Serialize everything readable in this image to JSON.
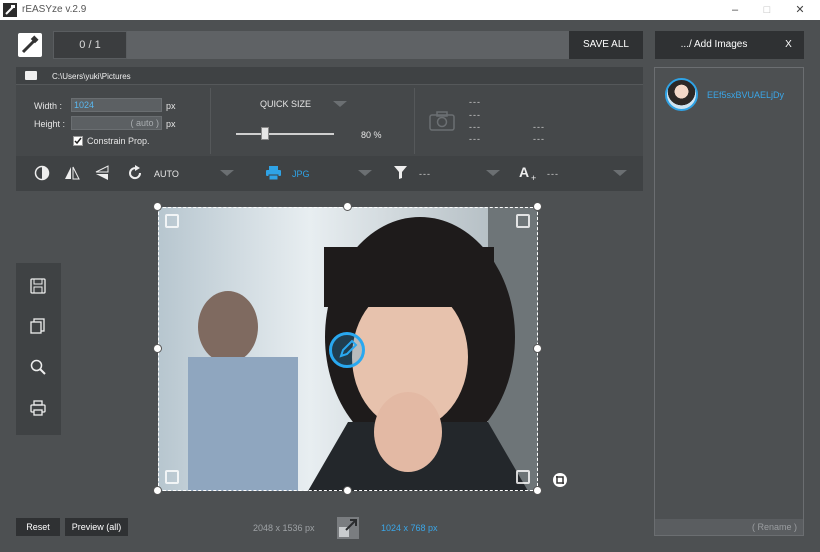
{
  "window": {
    "title": "rEASYze v.2.9",
    "minimize": "–",
    "maximize": "□",
    "close": "✕"
  },
  "toolbar": {
    "counter": "0 / 1",
    "save_all": "SAVE ALL",
    "add_images": ".../ Add Images",
    "close_x": "X"
  },
  "path": {
    "text": "C:\\Users\\yuki\\Pictures"
  },
  "size": {
    "width_label": "Width :",
    "width_value": "1024",
    "width_unit": "px",
    "height_label": "Height :",
    "height_placeholder": "( auto )",
    "height_unit": "px",
    "constrain_label": "Constrain Prop.",
    "constrain_checked": true
  },
  "quick_size": {
    "label": "QUICK SIZE",
    "value": "80 %",
    "fraction": 0.3
  },
  "exif": {
    "lines_left": [
      "---",
      "---",
      "---",
      "---"
    ],
    "lines_right": [
      "---",
      "---"
    ]
  },
  "effects": {
    "auto_label": "AUTO",
    "format_label": "JPG",
    "filter_value": "---",
    "text_value": "---",
    "accent": "#2fa3e6"
  },
  "files": [
    {
      "name": "EEf5sxBVUAELjDy"
    }
  ],
  "rename_label": "( Rename )",
  "bottom": {
    "reset": "Reset",
    "preview": "Preview (all)",
    "original_dims": "2048 x 1536 px",
    "output_dims": "1024 x 768 px"
  },
  "icons": {
    "sidebar": [
      "save-icon",
      "copy-icon",
      "zoom-icon",
      "print-icon"
    ],
    "effects": [
      "contrast-icon",
      "flip-horizontal-icon",
      "flip-vertical-icon",
      "rotate-icon",
      "format-icon",
      "filter-icon",
      "text-add-icon"
    ]
  }
}
